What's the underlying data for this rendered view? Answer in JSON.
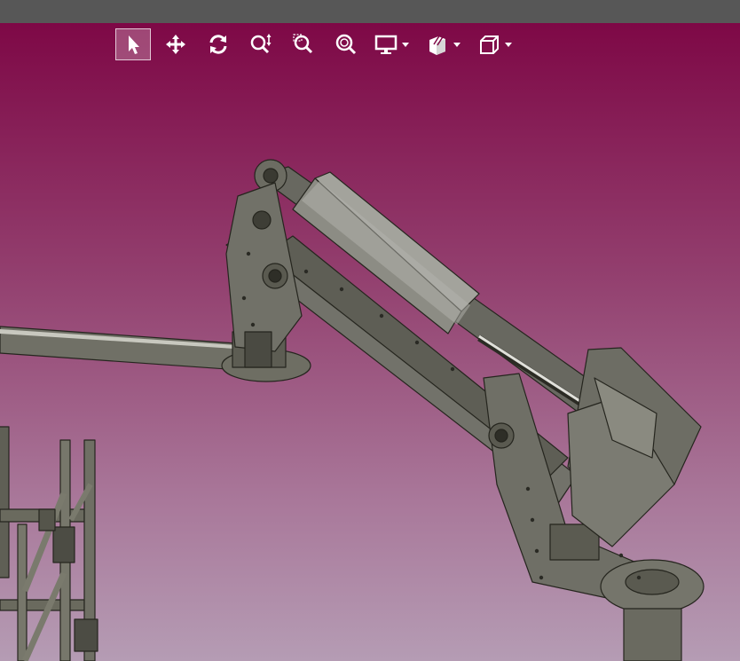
{
  "app": {
    "colors": {
      "titlebar": "#575757",
      "viewport_top": "#7e0846",
      "viewport_bottom": "#b59cb4",
      "model_body": "#6b6b5e",
      "model_edge": "#2a2a22",
      "cylinder": "#9a9a95",
      "icon": "#ffffff"
    }
  },
  "toolbar": {
    "buttons": [
      {
        "id": "select",
        "icon": "cursor-arrow-icon",
        "active": true
      },
      {
        "id": "pan",
        "icon": "move-arrows-icon",
        "active": false
      },
      {
        "id": "rotate",
        "icon": "rotate-icon",
        "active": false
      },
      {
        "id": "zoom",
        "icon": "zoom-vertical-icon",
        "active": false
      },
      {
        "id": "zoom-window",
        "icon": "zoom-window-icon",
        "active": false
      },
      {
        "id": "zoom-fit",
        "icon": "zoom-fit-icon",
        "active": false
      },
      {
        "id": "display-mode",
        "icon": "monitor-icon",
        "has_dropdown": true
      },
      {
        "id": "section",
        "icon": "section-box-icon",
        "has_dropdown": true
      },
      {
        "id": "standard-views",
        "icon": "view-cube-icon",
        "has_dropdown": true
      }
    ]
  }
}
